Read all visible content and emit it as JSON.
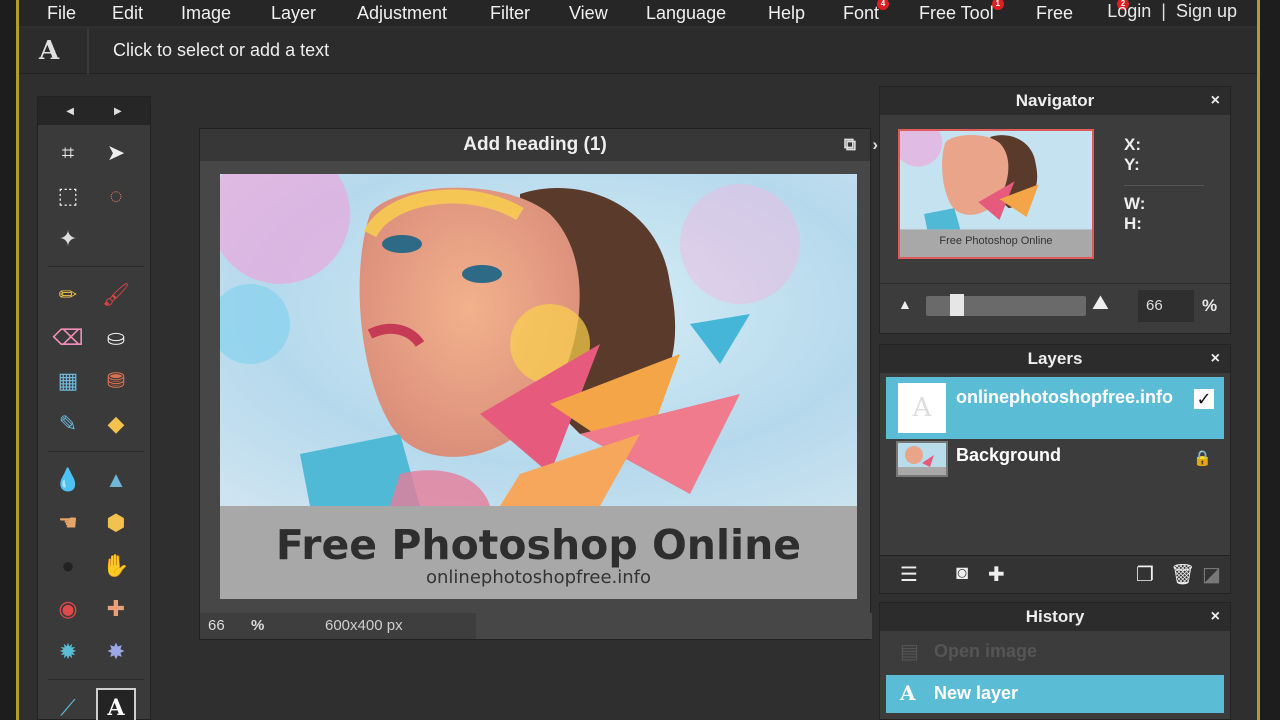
{
  "menubar": {
    "items": [
      {
        "label": "File"
      },
      {
        "label": "Edit"
      },
      {
        "label": "Image"
      },
      {
        "label": "Layer"
      },
      {
        "label": "Adjustment"
      },
      {
        "label": "Filter"
      },
      {
        "label": "View"
      },
      {
        "label": "Language"
      },
      {
        "label": "Help"
      },
      {
        "label": "Font",
        "badge": "4"
      },
      {
        "label": "Free Tool",
        "badge": "1"
      },
      {
        "label": "Free",
        "badge": "2"
      }
    ],
    "login_label": "Login",
    "separator": "|",
    "signup_label": "Sign up"
  },
  "options_bar": {
    "tool_glyph": "A",
    "hint": "Click to select or add a text"
  },
  "toolbox": {
    "prev_arrow": "◀",
    "next_arrow": "▶",
    "tools": [
      {
        "name": "crop-tool",
        "glyph": "⌗"
      },
      {
        "name": "move-tool",
        "glyph": "➤"
      },
      {
        "name": "marquee-tool",
        "glyph": "⬚"
      },
      {
        "name": "lasso-tool",
        "glyph": "◌"
      },
      {
        "name": "magic-wand-tool",
        "glyph": "✦"
      },
      {
        "name": "pencil-tool",
        "glyph": "✏"
      },
      {
        "name": "brush-tool",
        "glyph": "🖌"
      },
      {
        "name": "eraser-tool",
        "glyph": "⌫"
      },
      {
        "name": "paint-bucket-tool",
        "glyph": "⛀"
      },
      {
        "name": "gradient-tool",
        "glyph": "▦"
      },
      {
        "name": "clone-stamp-tool",
        "glyph": "⛃"
      },
      {
        "name": "color-replace-tool",
        "glyph": "✎"
      },
      {
        "name": "shape-tool",
        "glyph": "◆"
      },
      {
        "name": "blur-tool",
        "glyph": "💧"
      },
      {
        "name": "sharpen-tool",
        "glyph": "▲"
      },
      {
        "name": "smudge-tool",
        "glyph": "☚"
      },
      {
        "name": "sponge-tool",
        "glyph": "⬢"
      },
      {
        "name": "burn-tool",
        "glyph": "●"
      },
      {
        "name": "dodge-tool",
        "glyph": "✋"
      },
      {
        "name": "red-eye-tool",
        "glyph": "◉"
      },
      {
        "name": "spot-heal-tool",
        "glyph": "✚"
      },
      {
        "name": "bloat-tool",
        "glyph": "✹"
      },
      {
        "name": "pinch-tool",
        "glyph": "✸"
      },
      {
        "name": "color-picker-tool",
        "glyph": "⟋"
      },
      {
        "name": "type-tool",
        "glyph": "A"
      }
    ]
  },
  "document": {
    "title": "Add heading (1)",
    "caption_title": "Free Photoshop Online",
    "caption_url": "onlinephotoshopfree.info",
    "zoom": "66",
    "zoom_unit": "%",
    "size": "600x400 px"
  },
  "navigator": {
    "title": "Navigator",
    "close": "×",
    "thumb_caption": "Free Photoshop Online",
    "x_label": "X:",
    "y_label": "Y:",
    "w_label": "W:",
    "h_label": "H:",
    "zoom_value": "66",
    "zoom_unit": "%",
    "zoom_fraction": 0.15
  },
  "layers": {
    "title": "Layers",
    "close": "×",
    "items": [
      {
        "name": "onlinephotoshopfree.info",
        "glyph": "A",
        "visible": "✓"
      },
      {
        "name": "Background",
        "lock": "🔒"
      }
    ]
  },
  "history": {
    "title": "History",
    "close": "×",
    "items": [
      {
        "label": "Open image",
        "glyph": "▤"
      },
      {
        "label": "New layer",
        "glyph": "A"
      }
    ]
  },
  "colors": {
    "accent": "#5bbcd6",
    "frame": "#b69a2a",
    "badge": "#e02020"
  }
}
